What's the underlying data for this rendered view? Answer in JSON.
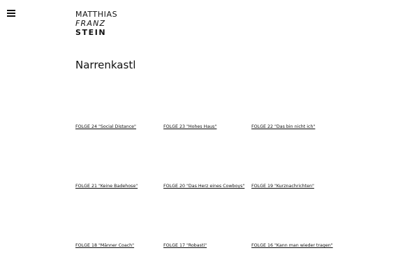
{
  "logo": {
    "line1": "MATTHIAS",
    "line2": "FRANZ",
    "line3": "STEIN"
  },
  "page": {
    "title": "Narrenkastl"
  },
  "episodes": [
    {
      "label": "FOLGE 24 \"Social Distance\""
    },
    {
      "label": "FOLGE 23 \"Hohes Haus\""
    },
    {
      "label": "FOLGE 22 \"Das bin nicht ich\""
    },
    {
      "label": "FOLGE 21 \"Keine Badehose\""
    },
    {
      "label": "FOLGE 20 \"Das Herz eines Cowboys\""
    },
    {
      "label": "FOLGE 19 \"Kurznachrichten\""
    },
    {
      "label": "FOLGE 18 \"Männer Coach\""
    },
    {
      "label": "FOLGE 17 \"Robasti\""
    },
    {
      "label": "FOLGE 16 \"Kann man wieder tragen\""
    }
  ]
}
